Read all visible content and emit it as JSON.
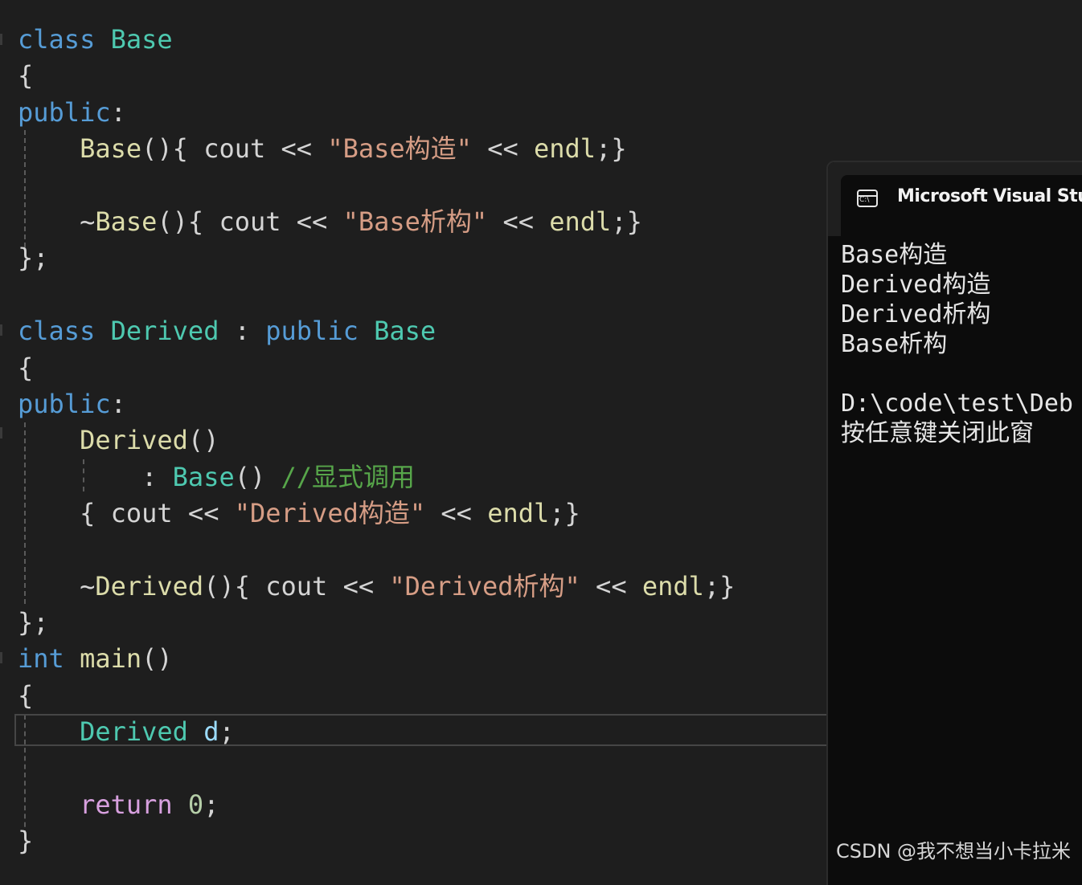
{
  "editor": {
    "lines": [
      {
        "tokens": [
          "class",
          "Base"
        ]
      },
      {
        "tokens": [
          "{"
        ]
      },
      {
        "tokens": [
          "public",
          ":"
        ]
      },
      {
        "tokens": [
          "Base",
          "()",
          "{",
          "cout",
          "<<",
          "\"Base构造\"",
          "<<",
          "endl",
          ";}"
        ]
      },
      {
        "tokens": [
          "~",
          "Base",
          "()",
          "{",
          "cout",
          "<<",
          "\"Base析构\"",
          "<<",
          "endl",
          ";}"
        ]
      },
      {
        "tokens": [
          "};"
        ]
      },
      {
        "tokens": [
          "class",
          "Derived",
          ":",
          "public",
          "Base"
        ]
      },
      {
        "tokens": [
          "{"
        ]
      },
      {
        "tokens": [
          "public",
          ":"
        ]
      },
      {
        "tokens": [
          "Derived",
          "()"
        ]
      },
      {
        "tokens": [
          ":",
          "Base",
          "()",
          "//显式调用"
        ]
      },
      {
        "tokens": [
          "{",
          "cout",
          "<<",
          "\"Derived构造\"",
          "<<",
          "endl",
          ";}"
        ]
      },
      {
        "tokens": [
          "~",
          "Derived",
          "()",
          "{",
          "cout",
          "<<",
          "\"Derived析构\"",
          "<<",
          "endl",
          ";}"
        ]
      },
      {
        "tokens": [
          "};"
        ]
      },
      {
        "tokens": [
          "int",
          "main",
          "()"
        ]
      },
      {
        "tokens": [
          "{"
        ]
      },
      {
        "tokens": [
          "Derived",
          "d",
          ";"
        ]
      },
      {
        "tokens": [
          "return",
          "0",
          ";"
        ]
      },
      {
        "tokens": [
          "}"
        ]
      }
    ]
  },
  "console": {
    "title": "Microsoft Visual Stud",
    "icon": "console-window-icon",
    "icon_text": "C:\\",
    "output": [
      "Base构造",
      "Derived构造",
      "Derived析构",
      "Base析构",
      "",
      "D:\\code\\test\\Deb",
      "按任意键关闭此窗"
    ]
  },
  "watermark": "CSDN @我不想当小卡拉米",
  "colors": {
    "background": "#1e1e1e",
    "keyword": "#569cd6",
    "type": "#4ec9b0",
    "function": "#dcdcaa",
    "string": "#d69d85",
    "comment": "#57a64a",
    "control": "#d8a0df",
    "number": "#b5cea8",
    "console_bg": "#0c0c0c"
  }
}
